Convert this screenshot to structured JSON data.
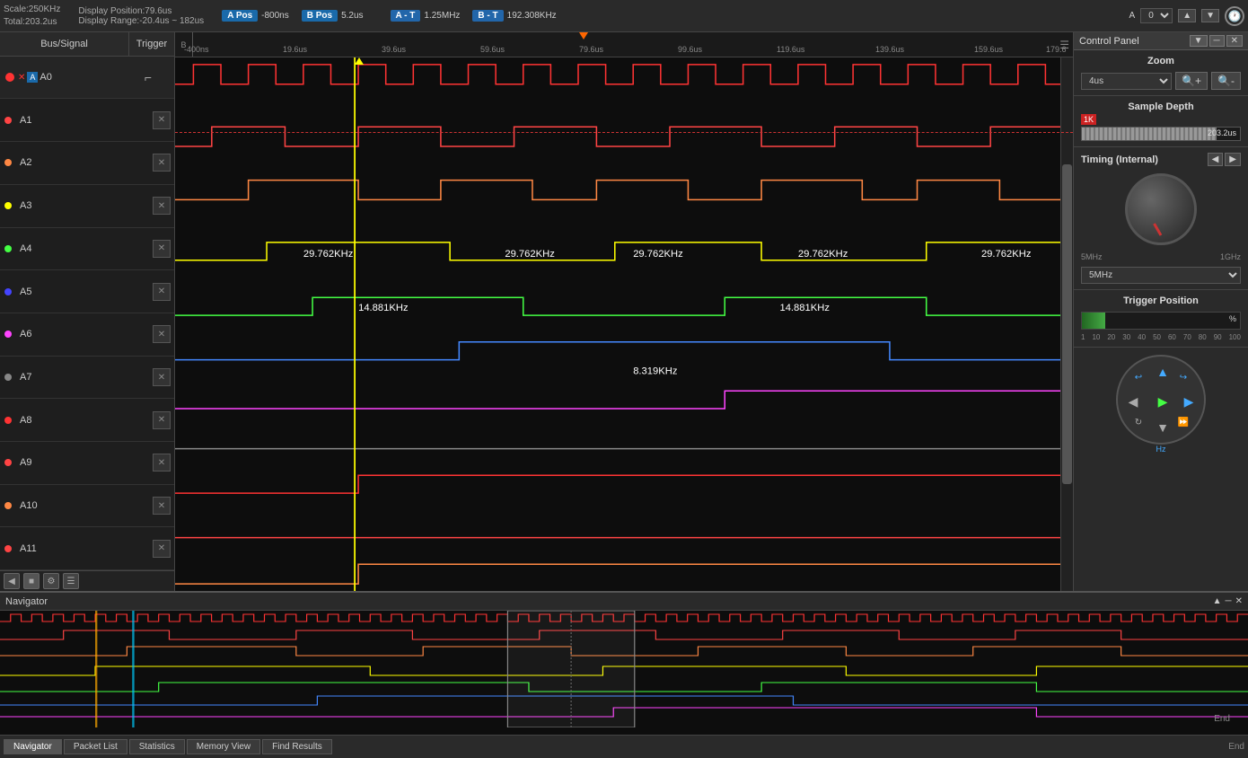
{
  "topBar": {
    "scale": "Scale:250KHz",
    "total": "Total:203.2us",
    "displayPos": "Display Position:79.6us",
    "displayRange": "Display Range:-20.4us ~ 182us",
    "aPos": "A Pos",
    "aPosVal": "-800ns",
    "bPos": "B Pos",
    "bPosVal": "5.2us",
    "at": "A - T",
    "atVal": "1.25MHz",
    "bt": "B - T",
    "btVal": "192.308KHz",
    "channelA": "A",
    "channelVal": "0"
  },
  "signals": [
    {
      "name": "A0",
      "color": "#ff3333",
      "active": true
    },
    {
      "name": "A1",
      "color": "#ff4444",
      "active": false
    },
    {
      "name": "A2",
      "color": "#ff8844",
      "active": false
    },
    {
      "name": "A3",
      "color": "#ffff00",
      "active": false
    },
    {
      "name": "A4",
      "color": "#44ff44",
      "active": false
    },
    {
      "name": "A5",
      "color": "#4444ff",
      "active": false
    },
    {
      "name": "A6",
      "color": "#ff44ff",
      "active": false
    },
    {
      "name": "A7",
      "color": "#888888",
      "active": false
    },
    {
      "name": "A8",
      "color": "#ff3333",
      "active": false
    },
    {
      "name": "A9",
      "color": "#ff4444",
      "active": false
    },
    {
      "name": "A10",
      "color": "#ff8844",
      "active": false
    },
    {
      "name": "A11",
      "color": "#ff4444",
      "active": false
    }
  ],
  "timeMarkers": [
    "-400ns",
    "19.6us",
    "39.6us",
    "59.6us",
    "79.6us",
    "99.6us",
    "119.6us",
    "139.6us",
    "159.6us",
    "179.6"
  ],
  "freqLabels": [
    "29.762KHz",
    "29.762KHz",
    "29.762KHz",
    "29.762KHz",
    "29.762KHz"
  ],
  "freqLabels2": [
    "14.881KHz",
    "14.881KHz"
  ],
  "freqLabel3": "8.319KHz",
  "controlPanel": {
    "title": "Control Panel",
    "zoomLabel": "Zoom",
    "zoomValue": "4us",
    "sampleDepthLabel": "Sample Depth",
    "sampleDepthValue": "203.2us",
    "sampleDepth1k": "1K",
    "timingLabel": "Timing (Internal)",
    "freq5mhz": "5MHz",
    "freq1ghz": "1GHz",
    "freqSelect": "5MHz",
    "triggerPosLabel": "Trigger Position",
    "triggerPercent": "%",
    "triggerNumbers": "1  10  20  30  40  50  60  70  80  90  100"
  },
  "tabs": {
    "navigator": "Navigator",
    "packetList": "Packet List",
    "statistics": "Statistics",
    "memoryView": "Memory View",
    "findResults": "Find Results"
  },
  "endLabel": "End"
}
